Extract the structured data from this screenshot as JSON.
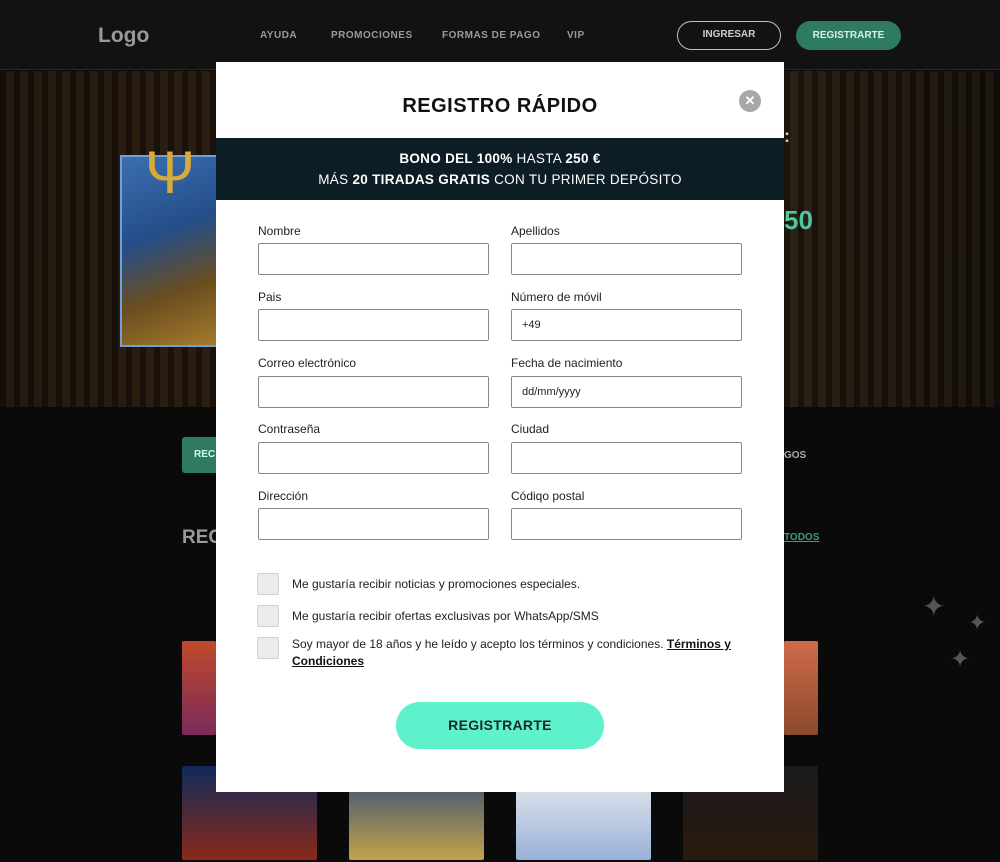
{
  "header": {
    "logo": "Logo",
    "nav": [
      "AYUDA",
      "PROMOCIONES",
      "FORMAS DE PAGO",
      "VIP"
    ],
    "login_label": "INGRESAR",
    "register_label": "REGISTRARTE"
  },
  "background": {
    "tab_label": "REC",
    "juegos_label": "GOS",
    "section_title": "REC",
    "see_all_label": "TODOS",
    "hero_amount_suffix": "50",
    "hero_colon": ":"
  },
  "modal": {
    "title": "REGISTRO RÁPIDO",
    "close_icon": "close-icon",
    "bonus": {
      "line1_bold1": "BONO DEL 100%",
      "line1_mid": " HASTA ",
      "line1_bold2": "250 €",
      "line2_pre": "MÁS ",
      "line2_bold": "20 TIRADAS GRATIS",
      "line2_post": " CON TU PRIMER DEPÓSITO"
    },
    "fields": {
      "nombre": {
        "label": "Nombre",
        "value": ""
      },
      "apellidos": {
        "label": "Apellidos",
        "value": ""
      },
      "pais": {
        "label": "Pais",
        "value": ""
      },
      "movil": {
        "label": "Número de móvil",
        "value": "+49"
      },
      "correo": {
        "label": "Correo electrónico",
        "value": ""
      },
      "nacimiento": {
        "label": "Fecha de nacimiento",
        "value": "dd/mm/yyyy"
      },
      "contrasena": {
        "label": "Contraseña",
        "value": ""
      },
      "ciudad": {
        "label": "Ciudad",
        "value": ""
      },
      "direccion": {
        "label": "Dirección",
        "value": ""
      },
      "postal": {
        "label": "Códiqo postal",
        "value": ""
      }
    },
    "checkboxes": {
      "news": "Me gustaría recibir noticias y promociones especiales.",
      "whatsapp": "Me gustaría recibir ofertas exclusivas por WhatsApp/SMS",
      "age_text": "Soy mayor de 18 años y he leído y acepto los términos y condiciones. ",
      "terms_link": "Términos y Condiciones"
    },
    "submit_label": "REGISTRARTE"
  },
  "colors": {
    "accent": "#5ff0cc",
    "bonus_bg": "#0d1d26",
    "header_button": "#2e7a63"
  }
}
